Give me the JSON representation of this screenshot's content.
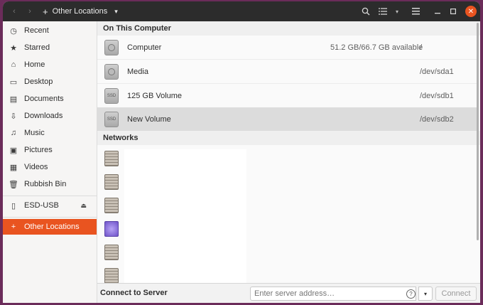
{
  "header": {
    "location_label": "Other Locations",
    "plus_glyph": "+",
    "caret_glyph": "▾",
    "back_glyph": "‹",
    "forward_glyph": "›",
    "search_glyph": "🔍",
    "list_glyph": "☰",
    "sort_glyph": "▾",
    "menu_glyph": "≡",
    "minimize_glyph": "—",
    "maximize_glyph": "□",
    "close_glyph": "✕",
    "accent_color": "#e95420"
  },
  "sidebar": {
    "items": [
      {
        "label": "Recent",
        "icon": "clock-icon",
        "glyph": "◷"
      },
      {
        "label": "Starred",
        "icon": "star-icon",
        "glyph": "★"
      },
      {
        "label": "Home",
        "icon": "home-icon",
        "glyph": "⌂"
      },
      {
        "label": "Desktop",
        "icon": "desktop-icon",
        "glyph": "▭"
      },
      {
        "label": "Documents",
        "icon": "document-icon",
        "glyph": "▤"
      },
      {
        "label": "Downloads",
        "icon": "download-icon",
        "glyph": "⇩"
      },
      {
        "label": "Music",
        "icon": "music-icon",
        "glyph": "♫"
      },
      {
        "label": "Pictures",
        "icon": "picture-icon",
        "glyph": "▣"
      },
      {
        "label": "Videos",
        "icon": "video-icon",
        "glyph": "▦"
      },
      {
        "label": "Rubbish Bin",
        "icon": "trash-icon",
        "glyph": "🗑"
      }
    ],
    "device": {
      "label": "ESD-USB",
      "icon": "usb-drive-icon",
      "glyph": "▯",
      "eject_glyph": "⏏"
    },
    "other_locations": {
      "label": "Other Locations",
      "glyph": "+"
    }
  },
  "main": {
    "on_this_computer": {
      "heading": "On This Computer",
      "rows": [
        {
          "name": "Computer",
          "available": "51.2 GB/66.7 GB available",
          "path": "/"
        },
        {
          "name": "Media",
          "available": "",
          "path": "/dev/sda1"
        },
        {
          "name": "125 GB Volume",
          "available": "",
          "path": "/dev/sdb1",
          "badge": "SSD"
        },
        {
          "name": "New Volume",
          "available": "",
          "path": "/dev/sdb2",
          "badge": "SSD"
        }
      ]
    },
    "networks": {
      "heading": "Networks"
    }
  },
  "bottom": {
    "title": "Connect to Server",
    "address_placeholder": "Enter server address…",
    "help_glyph": "?",
    "dropdown_glyph": "▾",
    "connect_label": "Connect"
  }
}
